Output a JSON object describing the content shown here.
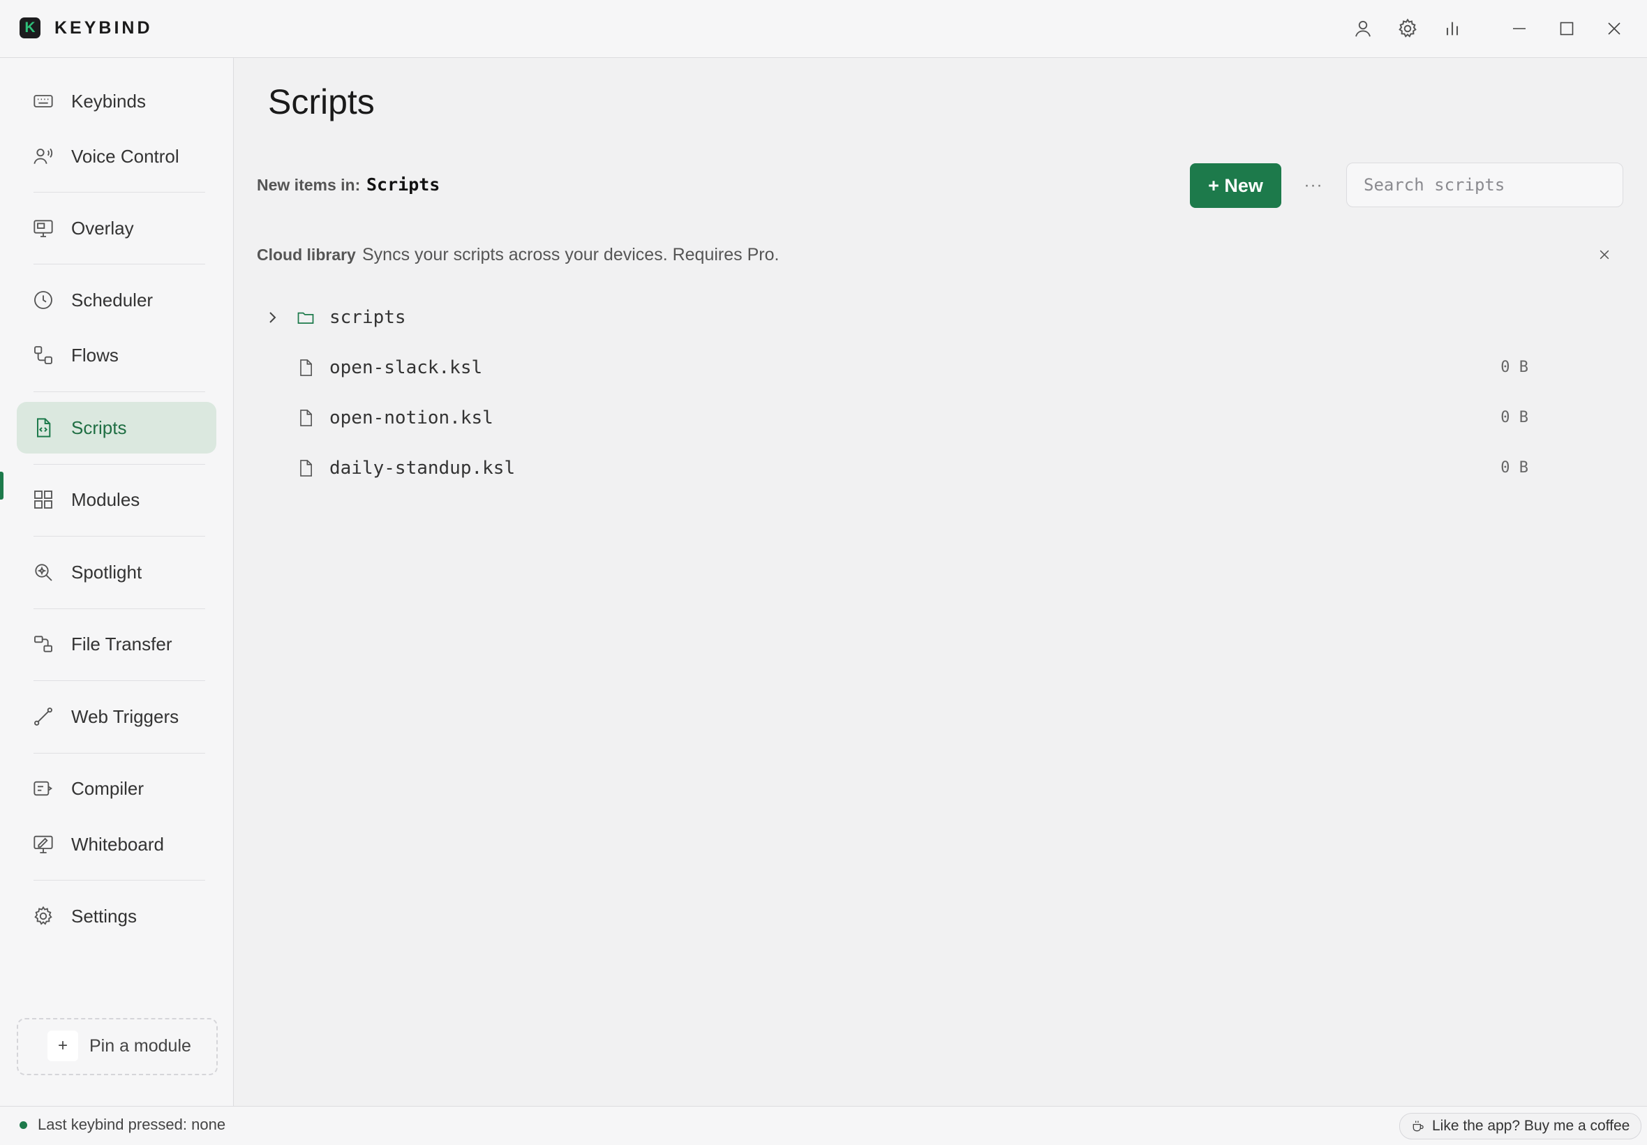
{
  "app": {
    "name": "KEYBIND",
    "logo_letter": "K"
  },
  "titlebar": {
    "icons": [
      "user-icon",
      "gear-icon",
      "stats-icon"
    ],
    "window_controls": [
      "minimize-icon",
      "maximize-icon",
      "close-icon"
    ]
  },
  "sidebar": {
    "items": [
      {
        "label": "Keybinds",
        "icon": "keyboard-icon"
      },
      {
        "label": "Voice Control",
        "icon": "voice-icon"
      },
      {
        "label": "Overlay",
        "icon": "monitor-icon"
      },
      {
        "label": "Scheduler",
        "icon": "clock-icon"
      },
      {
        "label": "Flows",
        "icon": "flows-icon"
      },
      {
        "label": "Scripts",
        "icon": "script-file-icon",
        "active": true
      },
      {
        "label": "Modules",
        "icon": "grid-icon"
      },
      {
        "label": "Spotlight",
        "icon": "spotlight-icon"
      },
      {
        "label": "File Transfer",
        "icon": "file-transfer-icon"
      },
      {
        "label": "Web Triggers",
        "icon": "web-trigger-icon"
      },
      {
        "label": "Compiler",
        "icon": "compiler-icon"
      },
      {
        "label": "Whiteboard",
        "icon": "whiteboard-icon"
      },
      {
        "label": "Settings",
        "icon": "gear-icon"
      }
    ],
    "pin_label": "Pin a module",
    "pin_symbol": "+"
  },
  "main": {
    "title": "Scripts",
    "location_label": "New items in:",
    "location_value": "Scripts",
    "new_button": "+ New",
    "more_symbol": "···",
    "search_placeholder": "Search scripts",
    "cloud_title": "Cloud library",
    "cloud_desc": "Syncs your scripts across your devices. Requires Pro.",
    "tree": [
      {
        "name": "scripts",
        "type": "folder",
        "size": ""
      },
      {
        "name": "open-slack.ksl",
        "type": "file",
        "size": "0 B"
      },
      {
        "name": "open-notion.ksl",
        "type": "file",
        "size": "0 B"
      },
      {
        "name": "daily-standup.ksl",
        "type": "file",
        "size": "0 B"
      }
    ]
  },
  "statusbar": {
    "last_keybind": "Last keybind pressed: none",
    "coffee": "Like the app? Buy me a coffee"
  },
  "colors": {
    "accent": "#1d7a4b",
    "active_bg": "#dbe8df",
    "logo_green": "#2fc07a"
  }
}
